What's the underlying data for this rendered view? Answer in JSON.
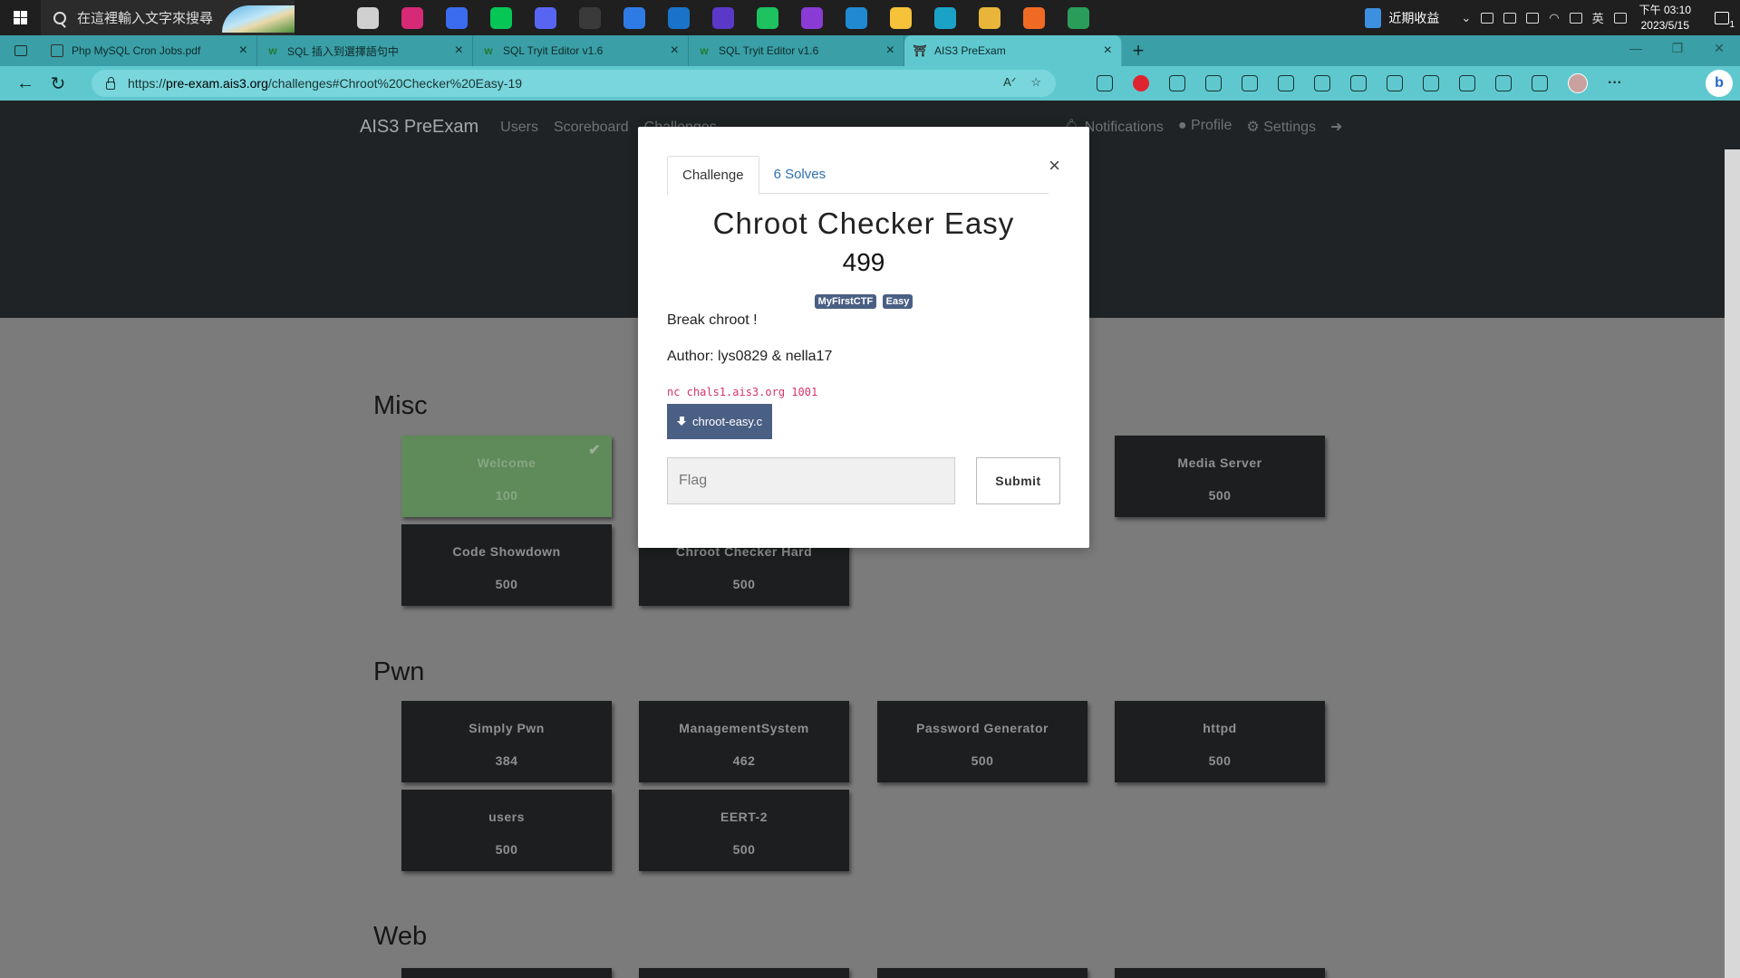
{
  "taskbar": {
    "search_placeholder": "在這裡輸入文字來搜尋",
    "apps": [
      {
        "icon": "task-view-icon",
        "color": "#1f1f1f"
      },
      {
        "icon": "notepad-icon",
        "color": "#d0d0d0"
      },
      {
        "icon": "instagram-icon",
        "color": "#d62976"
      },
      {
        "icon": "messenger-icon",
        "color": "#3b6cf0"
      },
      {
        "icon": "line-icon",
        "color": "#06c755"
      },
      {
        "icon": "discord-icon",
        "color": "#5865f2"
      },
      {
        "icon": "obs-icon",
        "color": "#3a3a3a"
      },
      {
        "icon": "todo-icon",
        "color": "#2f7be5"
      },
      {
        "icon": "mail-icon",
        "color": "#1a73c8"
      },
      {
        "icon": "intellij-icon",
        "color": "#5a38c8"
      },
      {
        "icon": "pycharm-icon",
        "color": "#1ec25e"
      },
      {
        "icon": "phpstorm-icon",
        "color": "#8a3bd4"
      },
      {
        "icon": "vscode-icon",
        "color": "#1f8ad2"
      },
      {
        "icon": "file-explorer-icon",
        "color": "#f5c23a"
      },
      {
        "icon": "edge-icon",
        "color": "#1ba3c7"
      },
      {
        "icon": "chrome-icon",
        "color": "#e8b53a"
      },
      {
        "icon": "firefox-icon",
        "color": "#f06a24"
      },
      {
        "icon": "app-icon",
        "color": "#2a9d5a"
      }
    ],
    "news_label": "近期收益",
    "ime_label": "英",
    "clock_time": "下午 03:10",
    "clock_date": "2023/5/15",
    "notification_count": "1"
  },
  "browser": {
    "tabs": [
      {
        "title": "Php MySQL Cron Jobs.pdf",
        "favicon": "pdf"
      },
      {
        "title": "SQL 插入到選擇語句中",
        "favicon": "w"
      },
      {
        "title": "SQL Tryit Editor v1.6",
        "favicon": "w"
      },
      {
        "title": "SQL Tryit Editor v1.6",
        "favicon": "w"
      },
      {
        "title": "AIS3 PreExam",
        "favicon": "ais"
      }
    ],
    "url_prefix": "https://",
    "url_host": "pre-exam.ais3.org",
    "url_path": "/challenges#Chroot%20Checker%20Easy-19",
    "accent_color": "#5fc8cf"
  },
  "site": {
    "brand": "AIS3 PreExam",
    "nav": [
      "Users",
      "Scoreboard",
      "Challenges"
    ],
    "nav_right": [
      "Notifications",
      "Profile",
      "Settings"
    ]
  },
  "sections": [
    {
      "title": "Misc",
      "cards": [
        {
          "name": "Welcome",
          "value": "100",
          "solved": true
        },
        {
          "name": "Media Server",
          "value": "500",
          "solved": false
        },
        {
          "name": "Code Showdown",
          "value": "500",
          "solved": false
        },
        {
          "name": "Chroot Checker Hard",
          "value": "500",
          "solved": false
        }
      ]
    },
    {
      "title": "Pwn",
      "cards": [
        {
          "name": "Simply Pwn",
          "value": "384",
          "solved": false
        },
        {
          "name": "ManagementSystem",
          "value": "462",
          "solved": false
        },
        {
          "name": "Password Generator",
          "value": "500",
          "solved": false
        },
        {
          "name": "httpd",
          "value": "500",
          "solved": false
        },
        {
          "name": "users",
          "value": "500",
          "solved": false
        },
        {
          "name": "EERT-2",
          "value": "500",
          "solved": false
        }
      ]
    },
    {
      "title": "Web",
      "cards": []
    }
  ],
  "modal": {
    "tab_challenge": "Challenge",
    "tab_solves": "6 Solves",
    "title": "Chroot Checker Easy",
    "value": "499",
    "tags": [
      "MyFirstCTF",
      "Easy"
    ],
    "description": "Break chroot !",
    "author": "Author: lys0829 & nella17",
    "connection": "nc chals1.ais3.org 1001",
    "file": "chroot-easy.c",
    "flag_placeholder": "Flag",
    "submit_label": "Submit",
    "close_symbol": "×"
  }
}
